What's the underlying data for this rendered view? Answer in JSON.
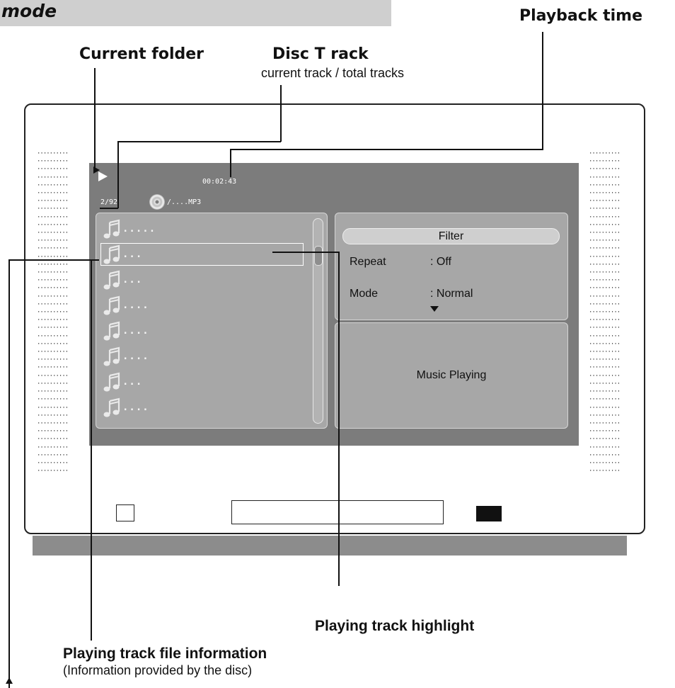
{
  "header": {
    "title": "mode"
  },
  "callouts": {
    "playback_time": "Playback  time",
    "current_folder": "Current folder",
    "disc_track": "Disc T rack",
    "disc_track_sub": "current track / total tracks",
    "playing_track_highlight": "Playing track  highlight",
    "playing_track_file_info": "Playing track   file information",
    "playing_track_file_info_sub": "(Information provided by  the disc)"
  },
  "osd": {
    "elapsed_time": "00:02:43",
    "track_counter": "2/92",
    "folder_path": "/....MP3"
  },
  "track_list": {
    "items": [
      {
        "label": "....."
      },
      {
        "label": "..."
      },
      {
        "label": "..."
      },
      {
        "label": "...."
      },
      {
        "label": "...."
      },
      {
        "label": "...."
      },
      {
        "label": "..."
      },
      {
        "label": "...."
      }
    ],
    "highlighted_index": 1
  },
  "settings": {
    "filter_label": "Filter",
    "repeat_label": "Repeat",
    "repeat_value": ": Off",
    "mode_label": "Mode",
    "mode_value": ": Normal"
  },
  "status": {
    "text": "Music Playing"
  },
  "icons": {
    "play": "play-icon",
    "disc": "disc-icon",
    "track": "music-note-icon",
    "more": "triangle-down-icon"
  },
  "colors": {
    "screen": "#7c7c7c",
    "panel": "#a7a7a7",
    "stand": "#8c8c8c",
    "header_bar": "#cfcfcf"
  }
}
